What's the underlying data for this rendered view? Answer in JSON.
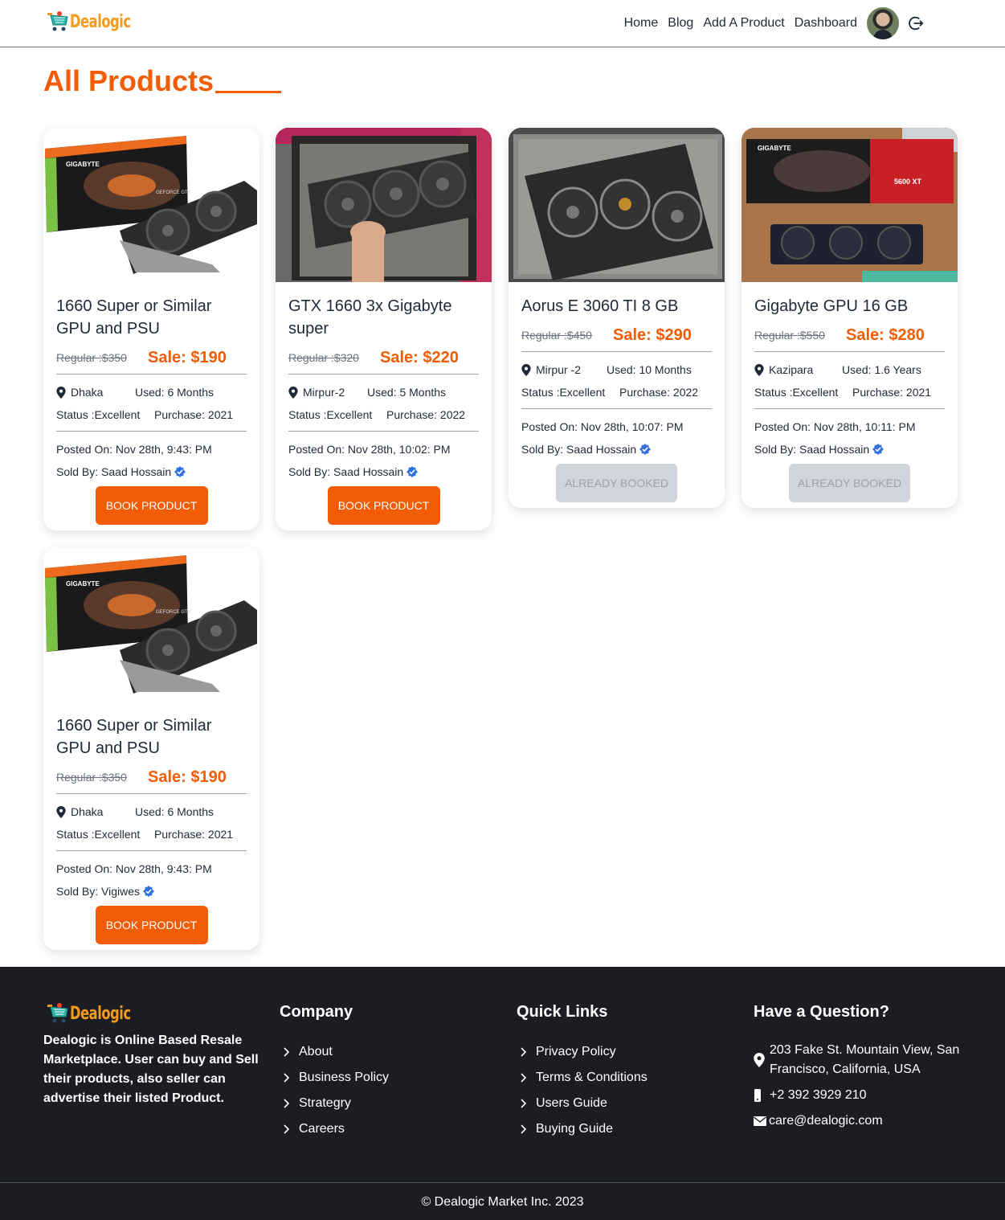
{
  "brand": {
    "name": "Dealogic",
    "color": "#f29b1d"
  },
  "nav": {
    "links": [
      "Home",
      "Blog",
      "Add A Product",
      "Dashboard"
    ]
  },
  "page": {
    "title": "All Products"
  },
  "accent": "#f25c05",
  "products": [
    {
      "title": "1660 Super or Similar GPU and PSU",
      "regular": "Regular :$350",
      "sale": "Sale: $190",
      "location": "Dhaka",
      "used": "Used: 6 Months",
      "status": "Status :Excellent",
      "purchase": "Purchase: 2021",
      "posted": "Posted On: Nov 28th, 9:43: PM",
      "seller": "Sold By: Saad Hossain",
      "button": "BOOK PRODUCT",
      "booked": false
    },
    {
      "title": "GTX 1660 3x Gigabyte super",
      "regular": "Regular :$320",
      "sale": "Sale: $220",
      "location": "Mirpur-2",
      "used": "Used: 5 Months",
      "status": "Status :Excellent",
      "purchase": "Purchase: 2022",
      "posted": "Posted On: Nov 28th, 10:02: PM",
      "seller": "Sold By: Saad Hossain",
      "button": "BOOK PRODUCT",
      "booked": false
    },
    {
      "title": "Aorus E 3060 TI 8 GB",
      "regular": "Regular :$450",
      "sale": "Sale: $290",
      "location": "Mirpur -2",
      "used": "Used: 10 Months",
      "status": "Status :Excellent",
      "purchase": "Purchase: 2022",
      "posted": "Posted On: Nov 28th, 10:07: PM",
      "seller": "Sold By: Saad Hossain",
      "button": "ALREADY BOOKED",
      "booked": true
    },
    {
      "title": "Gigabyte GPU 16 GB",
      "regular": "Regular :$550",
      "sale": "Sale: $280",
      "location": "Kazipara",
      "used": "Used: 1.6 Years",
      "status": "Status :Excellent",
      "purchase": "Purchase: 2021",
      "posted": "Posted On: Nov 28th, 10:11: PM",
      "seller": "Sold By: Saad Hossain",
      "button": "ALREADY BOOKED",
      "booked": true
    },
    {
      "title": "1660 Super or Similar GPU and PSU",
      "regular": "Regular :$350",
      "sale": "Sale: $190",
      "location": "Dhaka",
      "used": "Used: 6 Months",
      "status": "Status :Excellent",
      "purchase": "Purchase: 2021",
      "posted": "Posted On: Nov 28th, 9:43: PM",
      "seller": "Sold By: Vigiwes",
      "button": "BOOK PRODUCT",
      "booked": false
    }
  ],
  "footer": {
    "description": "Dealogic is Online Based Resale Marketplace. User can buy and Sell their products, also seller can advertise their listed Product.",
    "company": {
      "heading": "Company",
      "items": [
        "About",
        "Business Policy",
        "Strategry",
        "Careers"
      ]
    },
    "quick_links": {
      "heading": "Quick Links",
      "items": [
        "Privacy Policy",
        "Terms & Conditions",
        "Users Guide",
        "Buying Guide"
      ]
    },
    "contact": {
      "heading": "Have a Question?",
      "address": "203 Fake St. Mountain View, San Francisco, California, USA",
      "phone": "+2 392 3929 210",
      "email": "care@dealogic.com"
    },
    "copyright": "© Dealogic Market Inc. 2023"
  }
}
